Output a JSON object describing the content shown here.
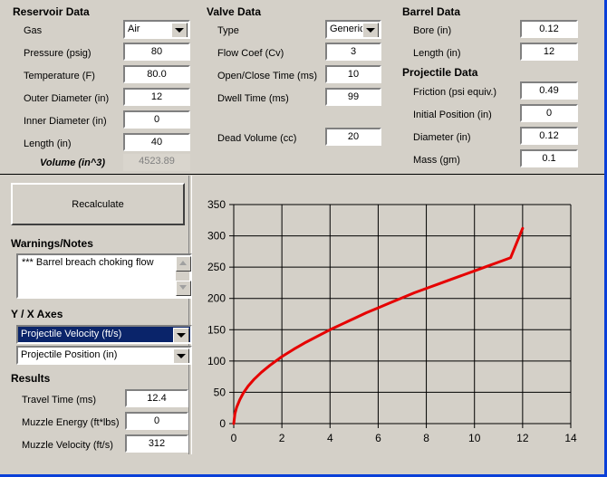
{
  "reservoir": {
    "title": "Reservoir Data",
    "rows": [
      {
        "label": "Gas",
        "value": "Air",
        "type": "combo"
      },
      {
        "label": "Pressure (psig)",
        "value": "80",
        "type": "field"
      },
      {
        "label": "Temperature (F)",
        "value": "80.0",
        "type": "field"
      },
      {
        "label": "Outer Diameter (in)",
        "value": "12",
        "type": "field"
      },
      {
        "label": "Inner Diameter (in)",
        "value": "0",
        "type": "field"
      },
      {
        "label": "Length (in)",
        "value": "40",
        "type": "field"
      },
      {
        "label": "Volume (in^3)",
        "value": "4523.89",
        "type": "readonly"
      }
    ]
  },
  "valve": {
    "title": "Valve Data",
    "rows": [
      {
        "label": "Type",
        "value": "Generic",
        "type": "combo"
      },
      {
        "label": "Flow Coef (Cv)",
        "value": "3",
        "type": "field"
      },
      {
        "label": "Open/Close Time (ms)",
        "value": "10",
        "type": "field"
      },
      {
        "label": "Dwell Time (ms)",
        "value": "99",
        "type": "field"
      },
      {
        "label": "Dead Volume (cc)",
        "value": "20",
        "type": "field"
      }
    ]
  },
  "barrel": {
    "title": "Barrel Data",
    "rows": [
      {
        "label": "Bore (in)",
        "value": "0.12"
      },
      {
        "label": "Length (in)",
        "value": "12"
      }
    ]
  },
  "projectile": {
    "title": "Projectile Data",
    "rows": [
      {
        "label": "Friction (psi equiv.)",
        "value": "0.49"
      },
      {
        "label": "Initial Position (in)",
        "value": "0"
      },
      {
        "label": "Diameter (in)",
        "value": "0.12"
      },
      {
        "label": "Mass (gm)",
        "value": "0.1"
      }
    ]
  },
  "actions": {
    "recalculate_label": "Recalculate"
  },
  "warnings": {
    "title": "Warnings/Notes",
    "text": "*** Barrel breach choking flow"
  },
  "axes": {
    "title": "Y / X Axes",
    "y_selected": "Projectile Velocity (ft/s)",
    "x_selected": "Projectile Position (in)"
  },
  "results": {
    "title": "Results",
    "rows": [
      {
        "label": "Travel Time (ms)",
        "value": "12.4"
      },
      {
        "label": "Muzzle Energy (ft*lbs)",
        "value": "0"
      },
      {
        "label": "Muzzle Velocity (ft/s)",
        "value": "312"
      }
    ]
  },
  "colors": {
    "face": "#d4d0c8",
    "curve": "#e60000",
    "accent": "#0a3fd8",
    "select": "#0a246a"
  },
  "chart_data": {
    "type": "line",
    "title": "",
    "xlabel": "Projectile Position (in)",
    "ylabel": "Projectile Velocity (ft/s)",
    "xlim": [
      0,
      14
    ],
    "ylim": [
      0,
      350
    ],
    "xticks": [
      0,
      2,
      4,
      6,
      8,
      10,
      12,
      14
    ],
    "yticks": [
      0,
      50,
      100,
      150,
      200,
      250,
      300,
      350
    ],
    "grid": true,
    "legend": "none",
    "series": [
      {
        "name": "Projectile Velocity (ft/s)",
        "color": "#e60000",
        "x": [
          0.0,
          0.05,
          0.12,
          0.25,
          0.4,
          0.6,
          0.85,
          1.15,
          1.5,
          2.0,
          2.5,
          3.0,
          3.5,
          4.0,
          4.5,
          5.0,
          5.5,
          6.0,
          6.5,
          7.0,
          7.5,
          8.0,
          8.5,
          9.0,
          9.5,
          10.0,
          10.5,
          11.0,
          11.5,
          12.0
        ],
        "y": [
          0,
          16,
          26,
          38,
          49,
          60,
          71,
          82,
          93,
          107,
          119,
          130,
          140,
          150,
          159,
          168,
          177,
          185,
          193,
          201,
          209,
          216,
          223,
          230,
          237,
          244,
          251,
          258,
          265,
          312
        ]
      }
    ]
  }
}
